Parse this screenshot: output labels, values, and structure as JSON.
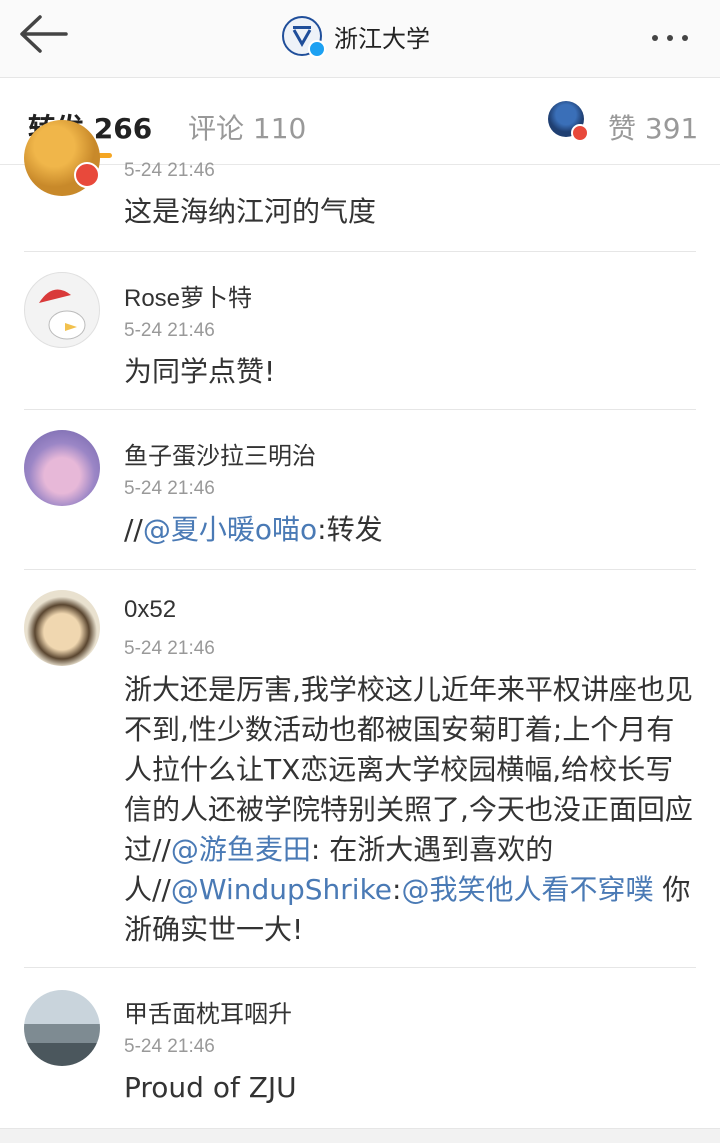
{
  "header": {
    "title": "浙江大学",
    "back_icon": "back-arrow-icon",
    "more_icon": "more-dots-icon",
    "logo_icon": "university-logo-icon"
  },
  "tabs": {
    "repost_label": "转发 266",
    "comment_label": "评论 110",
    "like_label": "赞 391",
    "active": "repost",
    "accent_color": "#f5a623"
  },
  "reposts": [
    {
      "username": "",
      "time": "5-24 21:46",
      "text": "这是海纳江河的气度"
    },
    {
      "username": "Rose萝卜特",
      "time": "5-24 21:46",
      "text": "为同学点赞!"
    },
    {
      "username": "鱼子蛋沙拉三明治",
      "time": "5-24 21:46",
      "text_prefix": "//",
      "mention": "@夏小暖o喵o",
      "text_suffix": ":转发"
    },
    {
      "username": "0x52",
      "time": "5-24 21:46",
      "text_main": "浙大还是厉害,我学校这儿近年来平权讲座也见不到,性少数活动也都被国安菊盯着;上个月有人拉什么让TX恋远离大学校园横幅,给校长写信的人还被学院特别关照了,今天也没正面回应过//",
      "mention1": "@游鱼麦田",
      "text_mid": ": 在浙大遇到喜欢的人//",
      "mention2": "@WindupShrike",
      "text_mid2": ":",
      "mention3": "@我笑他人看不穿噗",
      "text_end": " 你浙确实世一大!"
    },
    {
      "username": "甲舌面枕耳咽升",
      "time": "5-24 21:46",
      "text": "Proud of ZJU"
    }
  ],
  "colors": {
    "link": "#4a7ab5",
    "verified_badge": "#1da1f2",
    "vip_badge": "#e8493b"
  }
}
